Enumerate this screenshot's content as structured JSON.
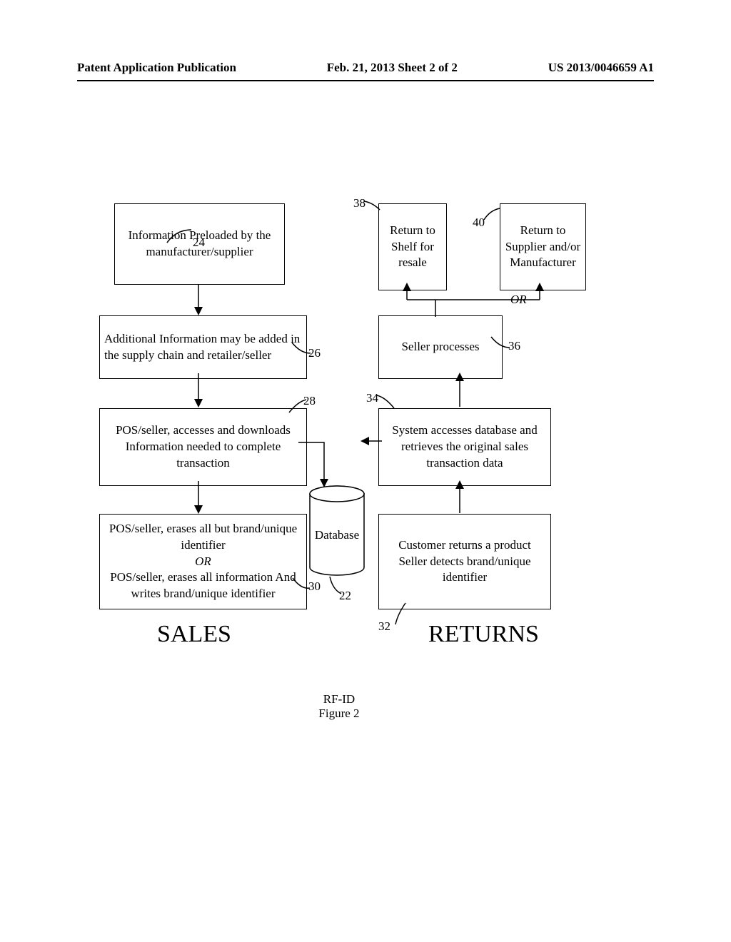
{
  "header": {
    "left": "Patent Application Publication",
    "center": "Feb. 21, 2013  Sheet 2 of 2",
    "right": "US 2013/0046659 A1"
  },
  "chart_data": {
    "type": "flowchart",
    "caption1": "RF-ID",
    "caption2": "Figure 2",
    "columns": {
      "sales": {
        "label": "SALES"
      },
      "returns": {
        "label": "RETURNS"
      }
    },
    "nodes": {
      "24": {
        "ref": "24",
        "text": "Information Preloaded by the manufacturer/supplier"
      },
      "26": {
        "ref": "26",
        "text": "Additional Information may be added in the supply chain and retailer/seller"
      },
      "28": {
        "ref": "28",
        "text": "POS/seller, accesses and downloads Information needed to complete transaction"
      },
      "30": {
        "ref": "30",
        "text_a": "POS/seller, erases all but brand/unique identifier",
        "or": "OR",
        "text_b": "POS/seller, erases all information And writes brand/unique identifier"
      },
      "32": {
        "ref": "32",
        "text_a": "Customer returns a product",
        "text_b": "Seller detects brand/unique identifier"
      },
      "34": {
        "ref": "34",
        "text": "System accesses database and retrieves the original sales transaction data"
      },
      "36": {
        "ref": "36",
        "text": "Seller processes"
      },
      "38": {
        "ref": "38",
        "text": "Return to Shelf for resale"
      },
      "40": {
        "ref": "40",
        "text": "Return to Supplier and/or Manufacturer"
      },
      "22": {
        "ref": "22",
        "label": "Database"
      }
    },
    "or_branch": "OR"
  }
}
